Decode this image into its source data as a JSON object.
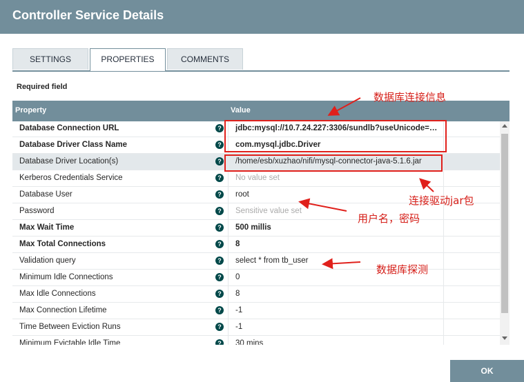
{
  "dialog": {
    "title": "Controller Service Details"
  },
  "tabs": [
    {
      "label": "SETTINGS",
      "active": false
    },
    {
      "label": "PROPERTIES",
      "active": true
    },
    {
      "label": "COMMENTS",
      "active": false
    }
  ],
  "required_label": "Required field",
  "grid": {
    "columns": {
      "property": "Property",
      "value": "Value"
    },
    "rows": [
      {
        "property": "Database Connection URL",
        "value": "jdbc:mysql://10.7.24.227:3306/sundlb?useUnicode=tr...",
        "required": true
      },
      {
        "property": "Database Driver Class Name",
        "value": "com.mysql.jdbc.Driver",
        "required": true
      },
      {
        "property": "Database Driver Location(s)",
        "value": "/home/esb/xuzhao/nifi/mysql-connector-java-5.1.6.jar",
        "required": false,
        "selected": true
      },
      {
        "property": "Kerberos Credentials Service",
        "value": "No value set",
        "required": false,
        "unset": true
      },
      {
        "property": "Database User",
        "value": "root",
        "required": false
      },
      {
        "property": "Password",
        "value": "Sensitive value set",
        "required": false,
        "unset": true
      },
      {
        "property": "Max Wait Time",
        "value": "500 millis",
        "required": true
      },
      {
        "property": "Max Total Connections",
        "value": "8",
        "required": true
      },
      {
        "property": "Validation query",
        "value": "select * from tb_user",
        "required": false
      },
      {
        "property": "Minimum Idle Connections",
        "value": "0",
        "required": false
      },
      {
        "property": "Max Idle Connections",
        "value": "8",
        "required": false
      },
      {
        "property": "Max Connection Lifetime",
        "value": "-1",
        "required": false
      },
      {
        "property": "Time Between Eviction Runs",
        "value": "-1",
        "required": false
      },
      {
        "property": "Minimum Evictable Idle Time",
        "value": "30 mins",
        "required": false
      }
    ],
    "help_icon": "?"
  },
  "footer": {
    "ok_label": "OK"
  },
  "annotations": {
    "db_connection_info": "数据库连接信息",
    "driver_jar": "连接驱动jar包",
    "user_password": "用户名，密码",
    "db_probe": "数据库探测"
  },
  "colors": {
    "header": "#728e9b",
    "annotation": "#e0201b",
    "help_icon": "#004849"
  }
}
